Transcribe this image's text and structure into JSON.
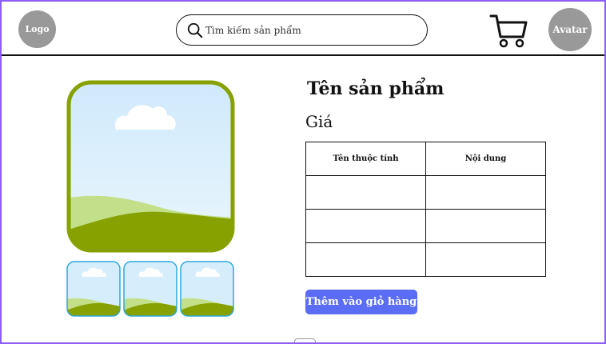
{
  "header": {
    "logo_label": "Logo",
    "search": {
      "placeholder": "Tìm kiếm sản phẩm",
      "icon": "search-icon"
    },
    "cart_icon": "cart-icon",
    "avatar_label": "Avatar"
  },
  "gallery": {
    "main_image": "landscape-placeholder-image",
    "thumbnails": [
      "landscape-placeholder-image",
      "landscape-placeholder-image",
      "landscape-placeholder-image"
    ]
  },
  "product": {
    "name": "Tên sản phẩm",
    "price": "Giá",
    "attributes": {
      "headers": [
        "Tên thuộc tính",
        "Nội dung"
      ],
      "rows": [
        [
          "",
          ""
        ],
        [
          "",
          ""
        ],
        [
          "",
          ""
        ]
      ]
    },
    "add_to_cart_label": "Thêm vào giỏ hàng"
  },
  "colors": {
    "accent": "#5b6cf5",
    "frame": "#8b5cf6",
    "placeholder_gray": "#999999",
    "image_border": "#86a100"
  }
}
